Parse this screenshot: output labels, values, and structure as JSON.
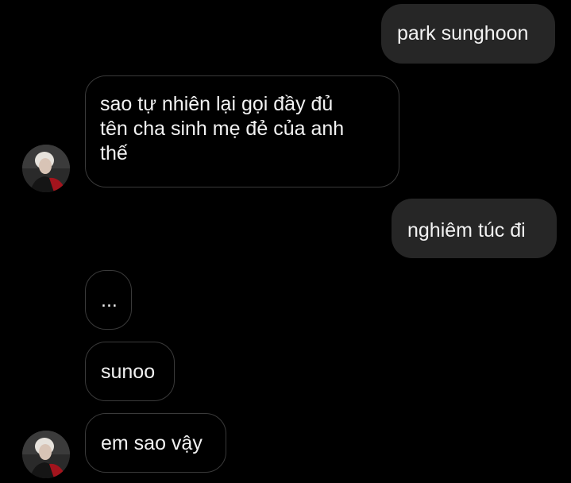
{
  "messages": [
    {
      "from": "me",
      "text": "park sunghoon"
    },
    {
      "from": "them",
      "lines": [
        "sao tự nhiên lại gọi đầy đủ",
        "tên cha sinh mẹ đẻ của anh",
        "thế"
      ]
    },
    {
      "from": "me",
      "text": "nghiêm túc đi"
    },
    {
      "from": "them",
      "text": "..."
    },
    {
      "from": "them",
      "text": "sunoo"
    },
    {
      "from": "them",
      "text": "em sao vậy"
    }
  ],
  "colors": {
    "background": "#000000",
    "sent_bubble": "#262626",
    "received_border": "#3a3a3a",
    "text": "#f2f2f2"
  },
  "icons": [
    "avatar-photo"
  ]
}
